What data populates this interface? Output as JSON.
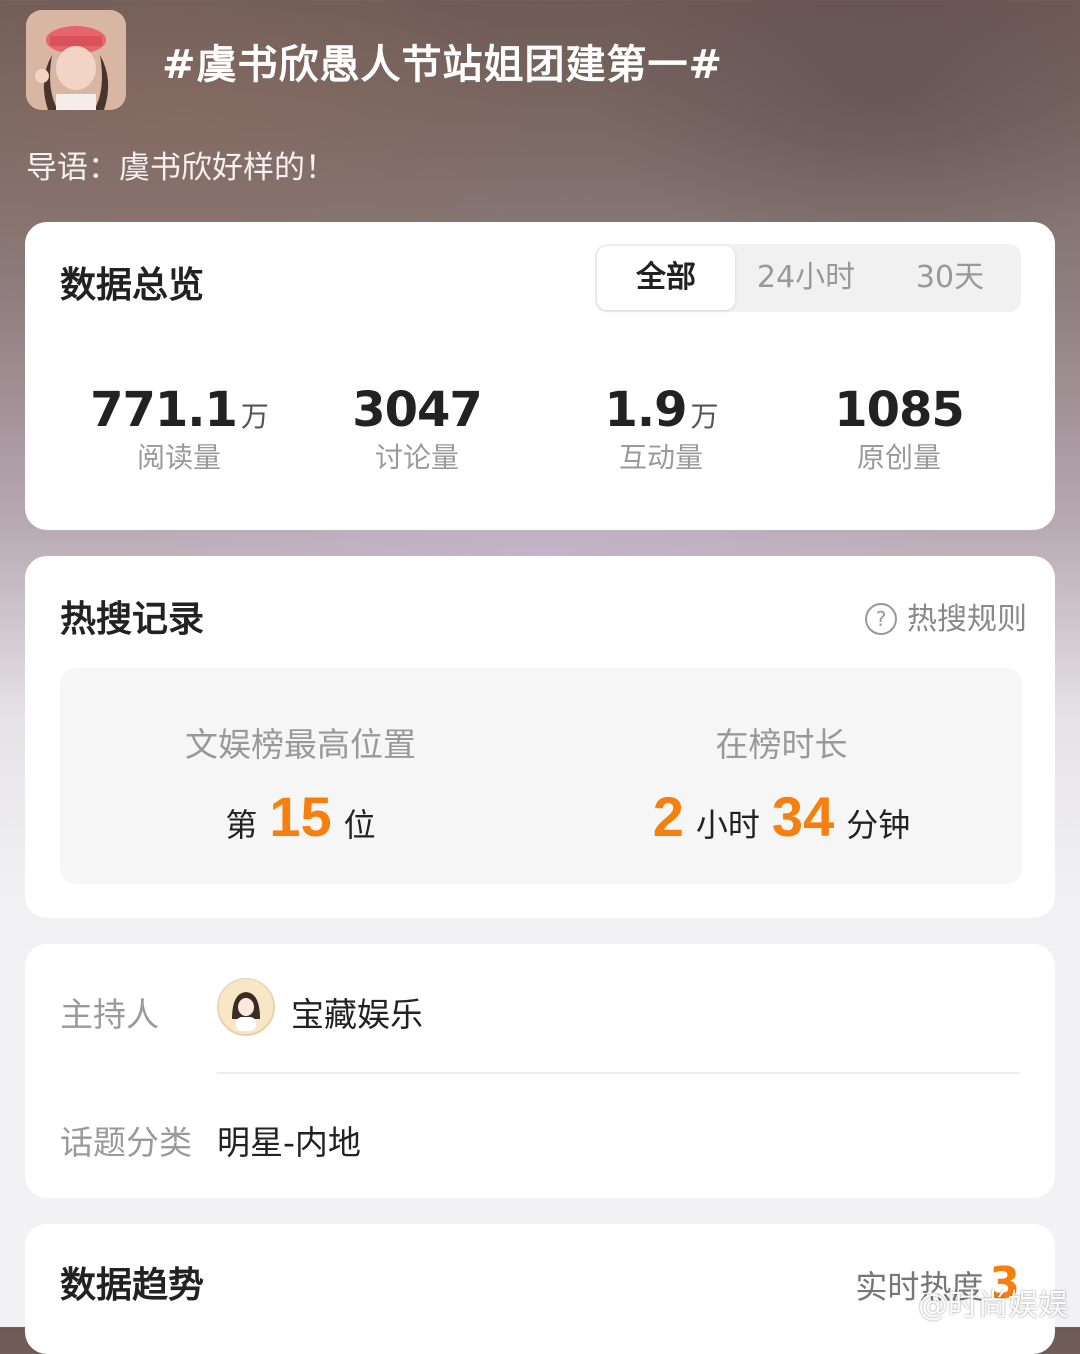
{
  "header": {
    "title": "#虞书欣愚人节站姐团建第一#",
    "intro": "导语：虞书欣好样的！"
  },
  "overview": {
    "title": "数据总览",
    "tabs": [
      "全部",
      "24小时",
      "30天"
    ],
    "active_tab": "全部",
    "stats": [
      {
        "value": "771.1",
        "unit": "万",
        "label": "阅读量"
      },
      {
        "value": "3047",
        "unit": "",
        "label": "讨论量"
      },
      {
        "value": "1.9",
        "unit": "万",
        "label": "互动量"
      },
      {
        "value": "1085",
        "unit": "",
        "label": "原创量"
      }
    ]
  },
  "hot_search": {
    "title": "热搜记录",
    "rules_link": "热搜规则",
    "highest": {
      "label": "文娱榜最高位置",
      "prefix": "第",
      "value": "15",
      "suffix": "位"
    },
    "duration": {
      "label": "在榜时长",
      "hours": "2",
      "hours_unit": "小时",
      "minutes": "34",
      "minutes_unit": "分钟"
    }
  },
  "info": {
    "host_label": "主持人",
    "host_name": "宝藏娱乐",
    "category_label": "话题分类",
    "category": "明星-内地"
  },
  "trend": {
    "title": "数据趋势",
    "realtime_label": "实时热度",
    "realtime_value": "3"
  },
  "watermark": "@时尚娱娱",
  "colors": {
    "accent": "#f5800f",
    "card": "#ffffff"
  }
}
